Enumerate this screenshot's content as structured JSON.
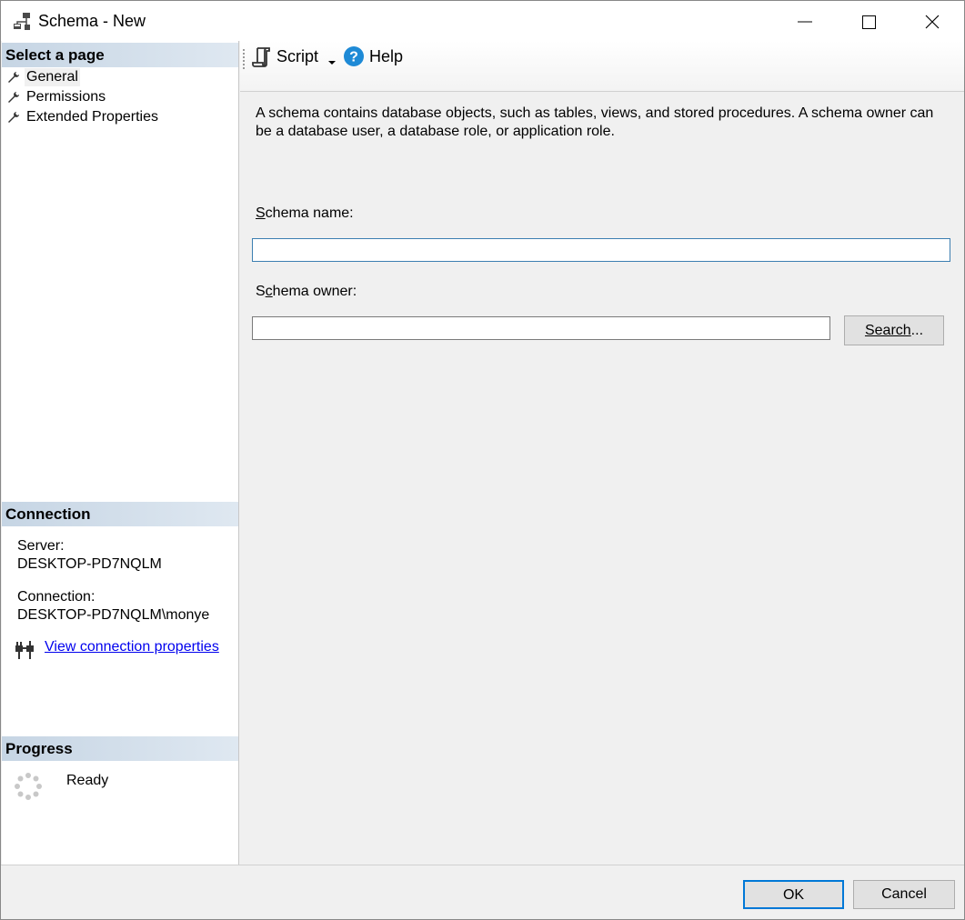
{
  "window": {
    "title": "Schema - New",
    "icon": "schema-icon",
    "controls": [
      "minimize-icon",
      "maximize-icon",
      "close-icon"
    ]
  },
  "left_panel": {
    "select_page_header": "Select a page",
    "pages": [
      {
        "label": "General",
        "icon": "wrench-icon",
        "selected": true
      },
      {
        "label": "Permissions",
        "icon": "wrench-icon",
        "selected": false
      },
      {
        "label": "Extended Properties",
        "icon": "wrench-icon",
        "selected": false
      }
    ],
    "connection_header": "Connection",
    "server_label": "Server:",
    "server_value": "DESKTOP-PD7NQLM",
    "connection_label": "Connection:",
    "connection_value": "DESKTOP-PD7NQLM\\monye",
    "view_connection_link": "View connection properties",
    "progress_header": "Progress",
    "progress_status": "Ready"
  },
  "toolbar": {
    "script_label": "Script",
    "help_label": "Help"
  },
  "main": {
    "description": "A schema contains database objects, such as tables, views, and stored procedures. A schema owner can be a database user, a database role, or application role.",
    "schema_name_label_first": "S",
    "schema_name_label_rest": "chema name:",
    "schema_name_value": "",
    "schema_owner_label_first": "S",
    "schema_owner_label_u": "c",
    "schema_owner_label_rest": "hema owner:",
    "schema_owner_value": "",
    "search_button_u": "Search",
    "search_button_rest": "..."
  },
  "footer": {
    "ok_label": "OK",
    "cancel_label": "Cancel"
  },
  "colors": {
    "section_header": "#c6d5e4",
    "link": "#0000ee",
    "focus_border": "#0078d7"
  }
}
